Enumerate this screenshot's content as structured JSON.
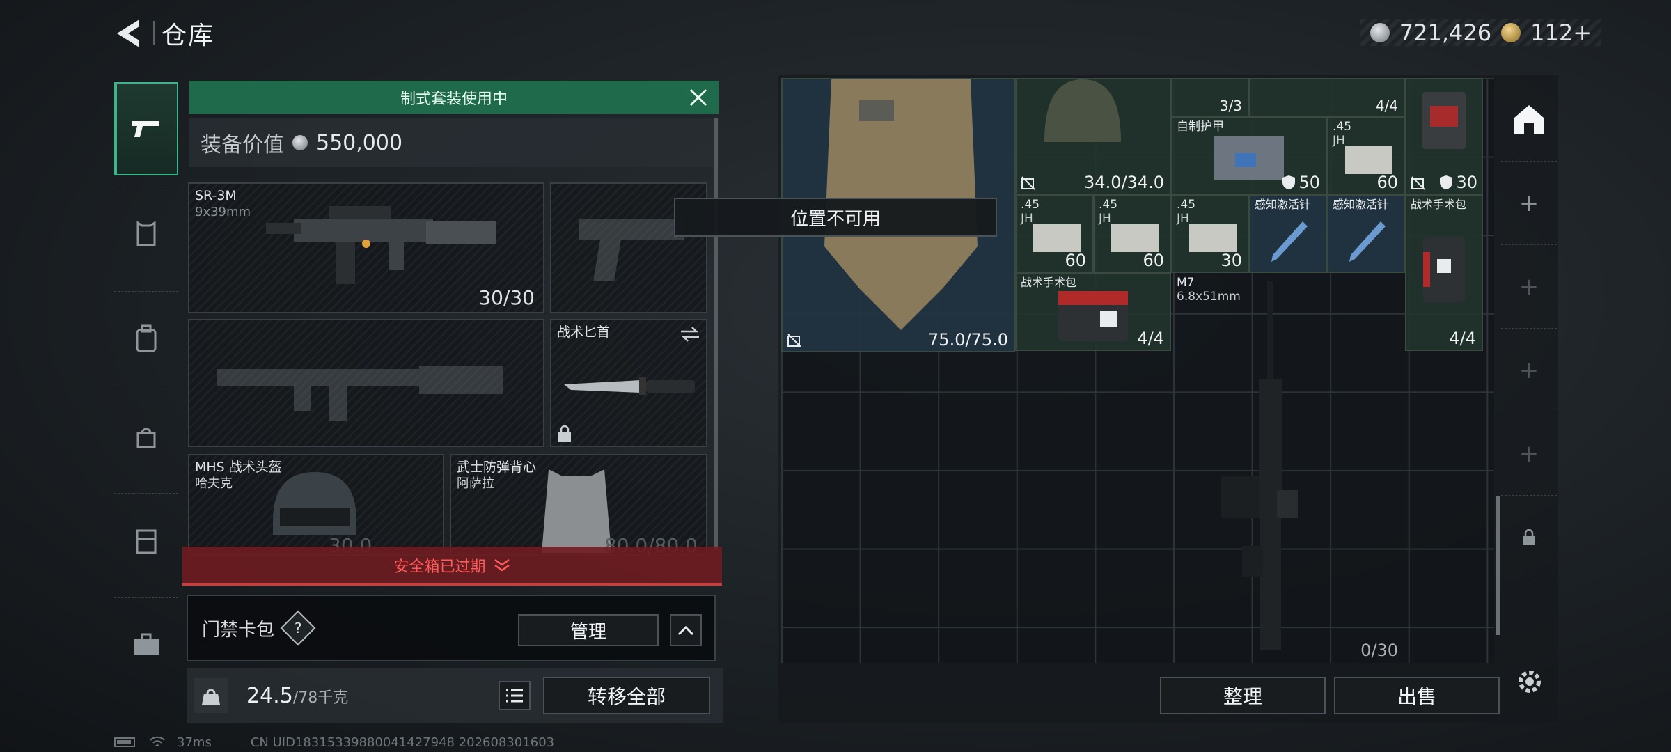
{
  "header": {
    "title": "仓库",
    "currency_silver": "721,426",
    "currency_gold": "112+"
  },
  "kit": {
    "banner": "制式套装使用中",
    "value_label": "装备价值",
    "value": "550,000"
  },
  "loadout": {
    "primary": {
      "name": "SR-3M",
      "caliber": "9x39mm",
      "ammo": "30/30"
    },
    "melee": {
      "name": "战术匕首"
    },
    "helmet": {
      "name": "MHS 战术头盔",
      "sub": "哈夫克",
      "durability": "30.0"
    },
    "armor": {
      "name": "武士防弹背心",
      "sub": "阿萨拉",
      "durability": "80.0/80.0"
    }
  },
  "safebox": {
    "status": "安全箱已过期"
  },
  "keycard": {
    "label": "门禁卡包",
    "help": "?",
    "manage": "管理"
  },
  "weight": {
    "value": "24.5",
    "max": "/78千克"
  },
  "actions": {
    "transfer_all": "转移全部",
    "tidy": "整理",
    "sell": "出售"
  },
  "tooltip": "位置不可用",
  "stash": {
    "items": [
      {
        "id": "vest",
        "count": "75.0/75.0"
      },
      {
        "id": "helmet",
        "count": "34.0/34.0"
      },
      {
        "id": "item-a",
        "count": "3/3"
      },
      {
        "id": "medkit-top",
        "count": "4/4"
      },
      {
        "id": "homemade-armor",
        "name": "自制护甲",
        "shield": "50"
      },
      {
        "id": "ammo-45-1",
        "name": ".45",
        "sub": "JH",
        "count": "60",
        "shield": "30"
      },
      {
        "id": "ammo-45-2",
        "name": ".45",
        "sub": "JH",
        "count": "60"
      },
      {
        "id": "ammo-45-3",
        "name": ".45",
        "sub": "JH",
        "count": "60"
      },
      {
        "id": "ammo-45-4",
        "name": ".45",
        "sub": "JH",
        "count": "30"
      },
      {
        "id": "stim-1",
        "name": "感知激活针"
      },
      {
        "id": "stim-2",
        "name": "感知激活针"
      },
      {
        "id": "surgery-1",
        "name": "战术手术包",
        "count": "4/4"
      },
      {
        "id": "surgery-2",
        "name": "战术手术包",
        "count": "4/4"
      },
      {
        "id": "m7",
        "name": "M7",
        "sub": "6.8x51mm",
        "count": "0/30"
      }
    ]
  },
  "status": {
    "ping": "37ms",
    "uid": "CN UID18315339880041427948 202608301603"
  },
  "colors": {
    "accent": "#3fb38b",
    "banner": "#1f6a4a",
    "danger": "#d23a3a"
  }
}
